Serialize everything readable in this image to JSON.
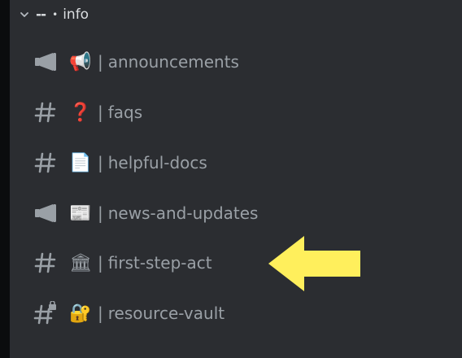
{
  "category": {
    "prefix": "--",
    "dot": "•",
    "name": "info"
  },
  "channels": [
    {
      "type": "announcement",
      "emoji": "📢",
      "separator": "|",
      "name": "announcements"
    },
    {
      "type": "text",
      "emoji": "❓",
      "separator": "|",
      "name": "faqs"
    },
    {
      "type": "text",
      "emoji": "📄",
      "separator": "|",
      "name": "helpful-docs"
    },
    {
      "type": "announcement",
      "emoji": "📰",
      "separator": "|",
      "name": "news-and-updates"
    },
    {
      "type": "text",
      "emoji": "🏛",
      "separator": "|",
      "name": "first-step-act"
    },
    {
      "type": "locked-text",
      "emoji": "🔐",
      "separator": "|",
      "name": "resource-vault"
    }
  ],
  "highlight_arrow": {
    "color": "#ffef5c",
    "points_to": "first-step-act"
  }
}
